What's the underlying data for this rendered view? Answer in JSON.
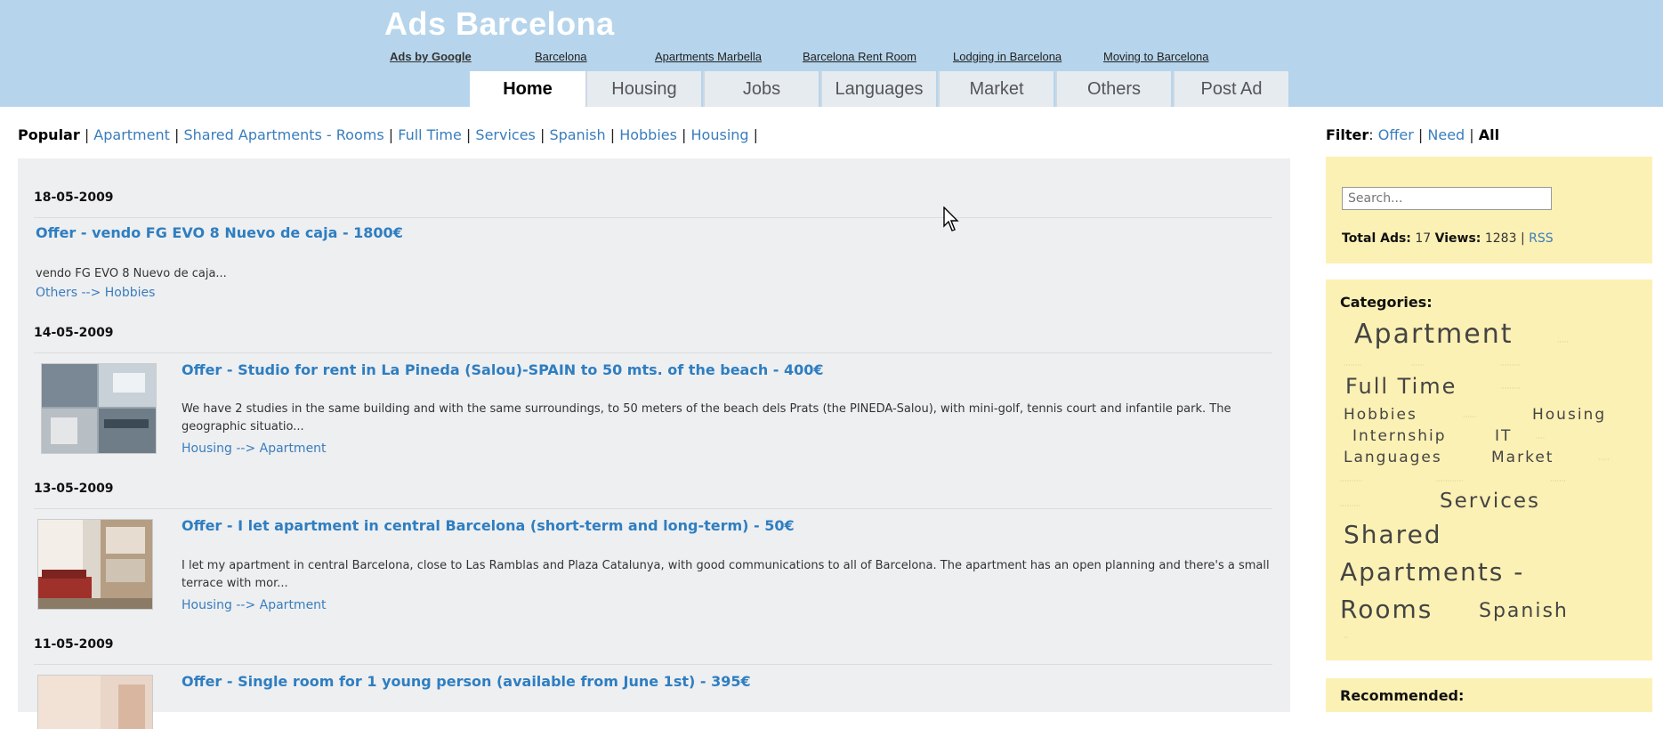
{
  "header": {
    "site_title": "Ads Barcelona",
    "ad_links": [
      "Ads by Google",
      "Barcelona",
      "Apartments Marbella",
      "Barcelona Rent Room",
      "Lodging in Barcelona",
      "Moving to Barcelona"
    ]
  },
  "tabs": [
    {
      "label": "Home",
      "active": true
    },
    {
      "label": "Housing",
      "active": false
    },
    {
      "label": "Jobs",
      "active": false
    },
    {
      "label": "Languages",
      "active": false
    },
    {
      "label": "Market",
      "active": false
    },
    {
      "label": "Others",
      "active": false
    },
    {
      "label": "Post Ad",
      "active": false
    }
  ],
  "popular": {
    "label": "Popular",
    "links": [
      "Apartment",
      "Shared Apartments - Rooms",
      "Full Time",
      "Services",
      "Spanish",
      "Hobbies",
      "Housing"
    ]
  },
  "ads": [
    {
      "date": "18-05-2009",
      "title": "Offer - vendo FG EVO 8 Nuevo de caja - 1800€",
      "description": "vendo FG EVO 8 Nuevo de caja...",
      "category": "Others --> Hobbies",
      "has_thumb": false
    },
    {
      "date": "14-05-2009",
      "title": "Offer - Studio for rent in La Pineda (Salou)-SPAIN to 50 mts. of the beach - 400€",
      "description": "We have 2 studies in the same building and with the same surroundings, to 50 meters of the beach dels Prats (the PINEDA-Salou), with mini-golf, tennis court and infantile park. The geographic situatio...",
      "category": "Housing --> Apartment",
      "has_thumb": true
    },
    {
      "date": "13-05-2009",
      "title": "Offer - I let apartment in central Barcelona (short-term and long-term) - 50€",
      "description": "I let my apartment in central Barcelona, close to Las Ramblas and Plaza Catalunya, with good communications to all of Barcelona. The apartment has an open planning and there's a small terrace with mor...",
      "category": "Housing --> Apartment",
      "has_thumb": true
    },
    {
      "date": "11-05-2009",
      "title": "Offer - Single room for 1 young person (available from June 1st) - 395€",
      "has_thumb": true
    }
  ],
  "filter": {
    "label": "Filter",
    "options": [
      "Offer",
      "Need",
      "All"
    ]
  },
  "search": {
    "placeholder": "Search..."
  },
  "stats": {
    "total_label": "Total Ads:",
    "total_value": "17",
    "views_label": "Views:",
    "views_value": "1283",
    "rss": "RSS"
  },
  "categories": {
    "heading": "Categories:",
    "tags": [
      "Apartment",
      "Full Time",
      "Hobbies",
      "Housing",
      "Internship",
      "IT",
      "Languages",
      "Market",
      "Services",
      "Shared",
      "Apartments -",
      "Rooms",
      "Spanish"
    ]
  },
  "recommended": {
    "heading": "Recommended:"
  },
  "colors": {
    "header_bg": "#b6d5ec",
    "link": "#3a7dbd",
    "title_link": "#2e7ec1",
    "sidebar_box": "#fcf1b4",
    "content_bg": "#eeeff1"
  }
}
